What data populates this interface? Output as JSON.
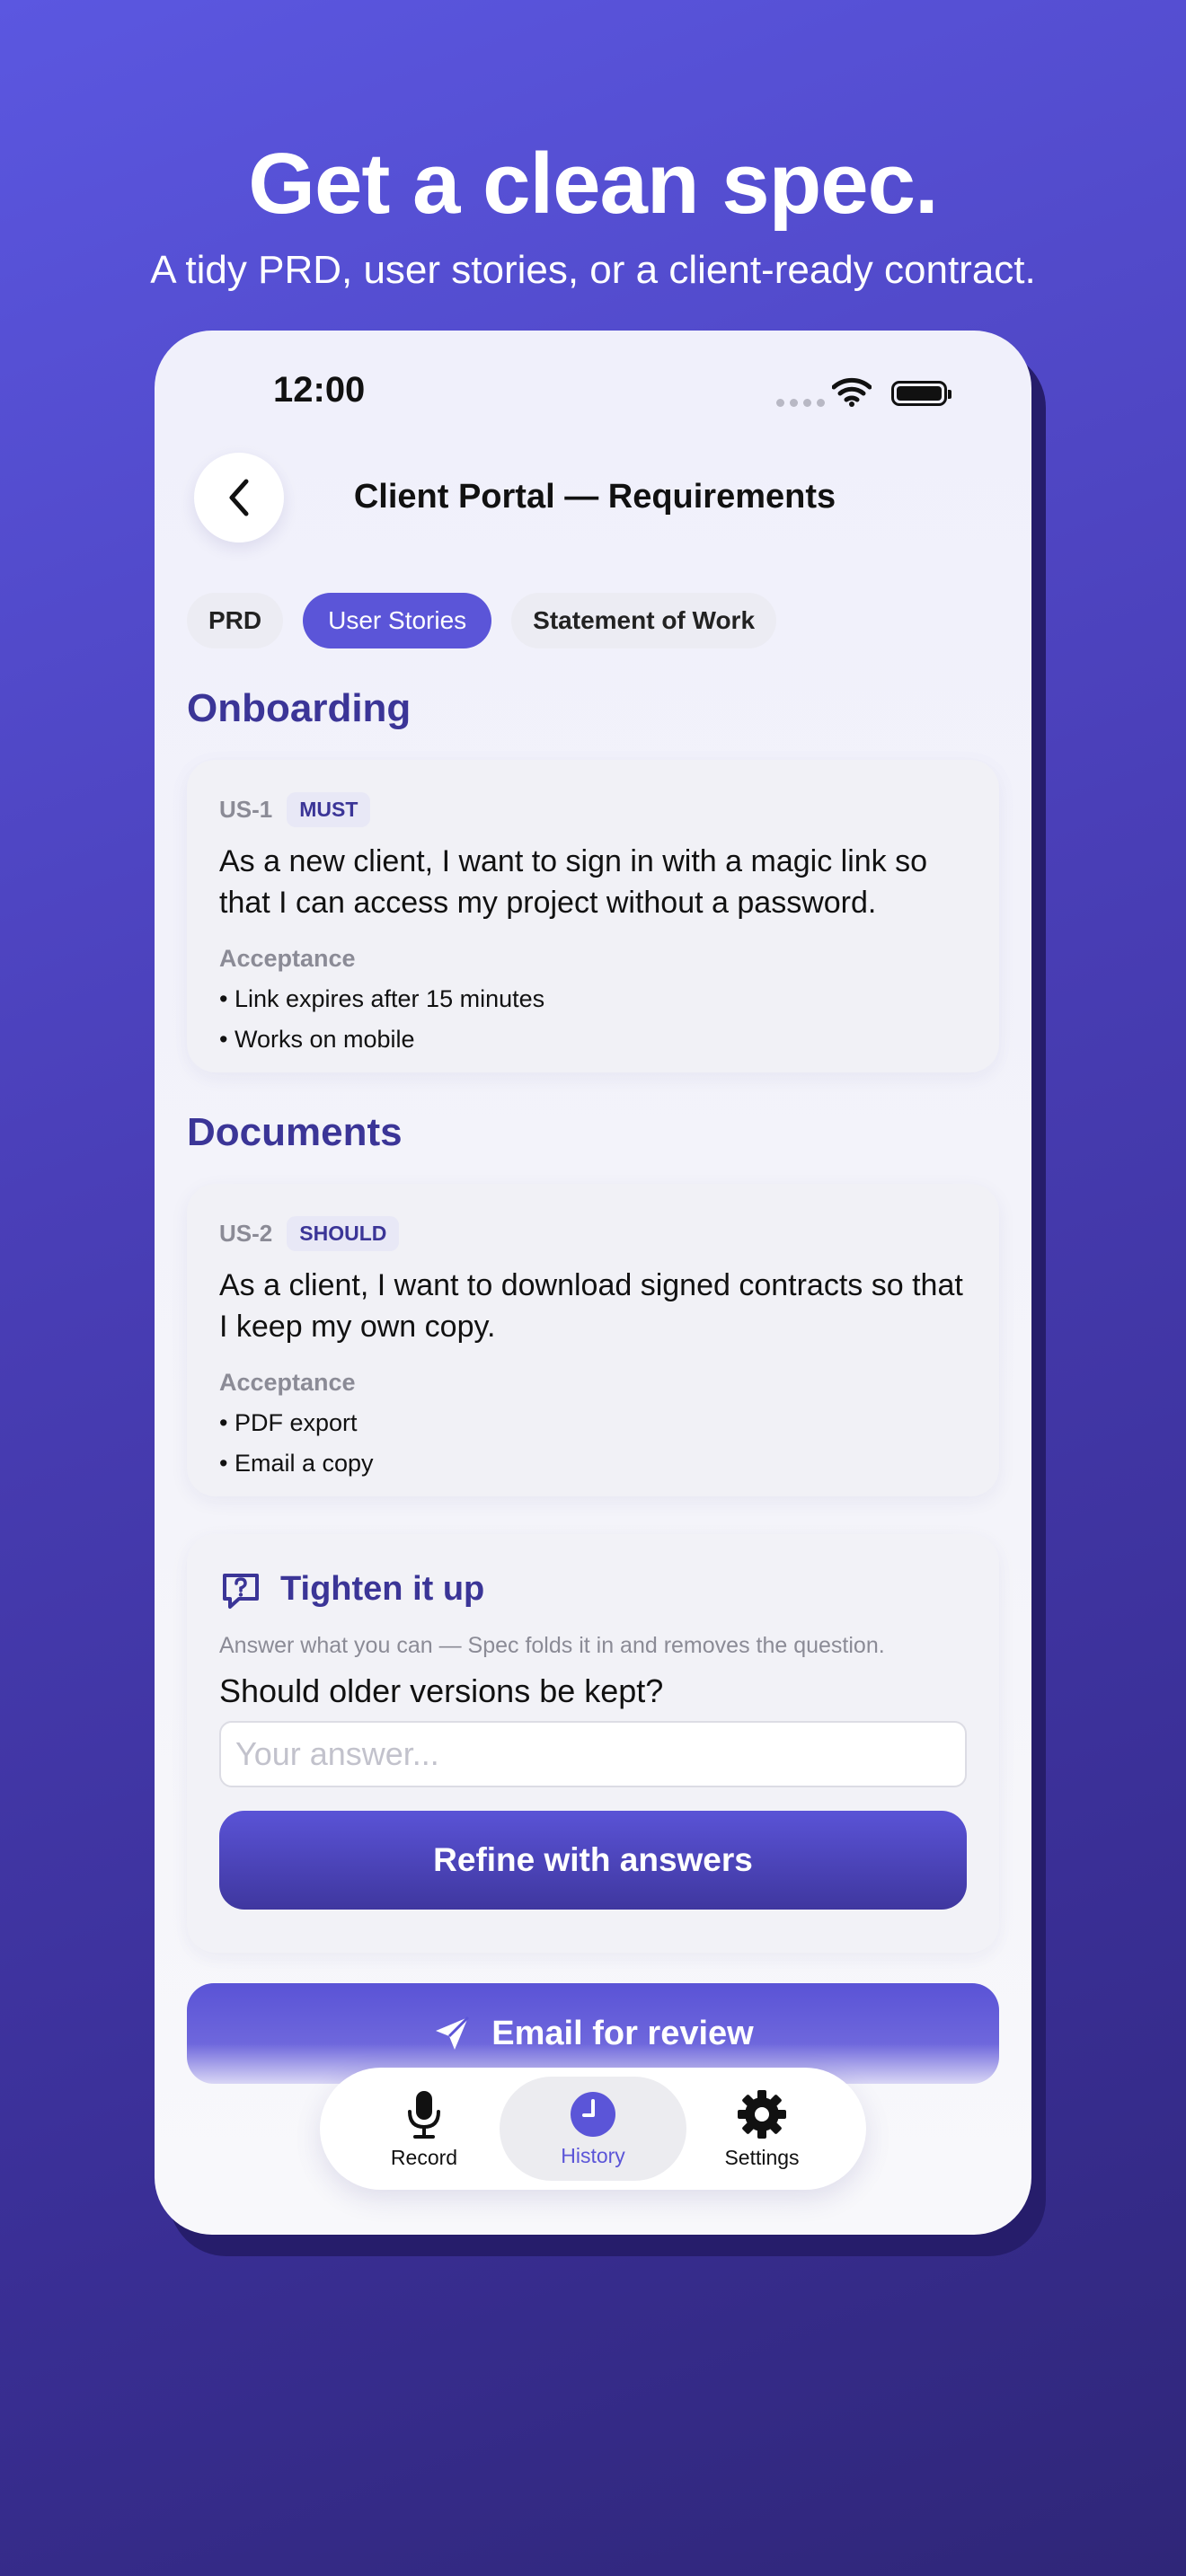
{
  "marketing": {
    "headline": "Get a clean spec.",
    "subhead": "A tidy PRD, user stories, or a client-ready contract."
  },
  "status_bar": {
    "time": "12:00"
  },
  "header": {
    "title": "Client Portal — Requirements",
    "back_icon": "chevron-left-icon"
  },
  "tabs": [
    {
      "label": "PRD",
      "active": false
    },
    {
      "label": "User Stories",
      "active": true
    },
    {
      "label": "Statement of Work",
      "active": false
    }
  ],
  "sections": [
    {
      "heading": "Onboarding",
      "story": {
        "id": "US-1",
        "priority": "MUST",
        "text": "As a new client, I want to sign in with a magic link so that I can access my project without a password.",
        "acceptance_label": "Acceptance",
        "criteria": [
          "• Link expires after 15 minutes",
          "• Works on mobile"
        ]
      }
    },
    {
      "heading": "Documents",
      "story": {
        "id": "US-2",
        "priority": "SHOULD",
        "text": "As a client, I want to download signed contracts so that I keep my own copy.",
        "acceptance_label": "Acceptance",
        "criteria": [
          "• PDF export",
          "• Email a copy"
        ]
      }
    }
  ],
  "tighten": {
    "title": "Tighten it up",
    "help": "Answer what you can — Spec folds it in and removes the question.",
    "question": "Should older versions be kept?",
    "input_value": "",
    "input_placeholder": "Your answer...",
    "button_label": "Refine with answers"
  },
  "email_button": {
    "label": "Email for review"
  },
  "nav": [
    {
      "label": "Record",
      "icon": "microphone-icon",
      "active": false
    },
    {
      "label": "History",
      "icon": "clock-icon",
      "active": true
    },
    {
      "label": "Settings",
      "icon": "gear-icon",
      "active": false
    }
  ],
  "colors": {
    "accent": "#5b55d8",
    "heading": "#3b3597",
    "background_top": "#5b57e0",
    "background_bottom": "#2f2678"
  }
}
